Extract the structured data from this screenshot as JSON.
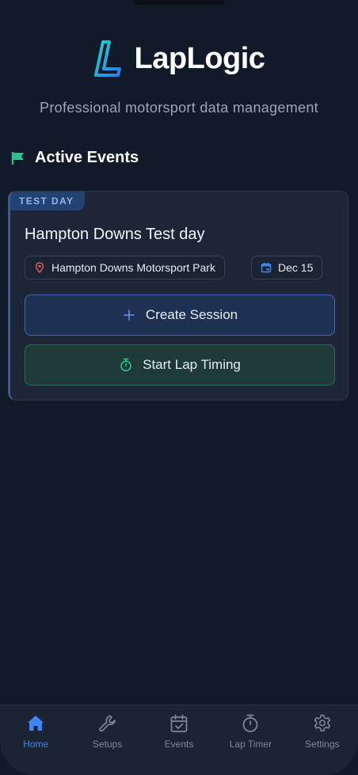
{
  "app": {
    "name": "LapLogic",
    "tagline": "Professional motorsport data management"
  },
  "section": {
    "title": "Active Events",
    "icon": "flag-icon"
  },
  "event": {
    "badge": "TEST DAY",
    "title": "Hampton Downs Test day",
    "location": "Hampton Downs Motorsport Park",
    "date": "Dec 15",
    "create_session_label": "Create Session",
    "start_timing_label": "Start Lap Timing"
  },
  "tabs": [
    {
      "label": "Home",
      "icon": "home-icon",
      "active": true
    },
    {
      "label": "Setups",
      "icon": "wrench-icon",
      "active": false
    },
    {
      "label": "Events",
      "icon": "calendar-check-icon",
      "active": false
    },
    {
      "label": "Lap Timer",
      "icon": "stopwatch-icon",
      "active": false
    },
    {
      "label": "Settings",
      "icon": "gear-icon",
      "active": false
    }
  ],
  "colors": {
    "background": "#111a28",
    "accent": "#3e86f5",
    "success": "#2fbf8a",
    "badge": "#24426f",
    "location_pin": "#e45b5b"
  }
}
